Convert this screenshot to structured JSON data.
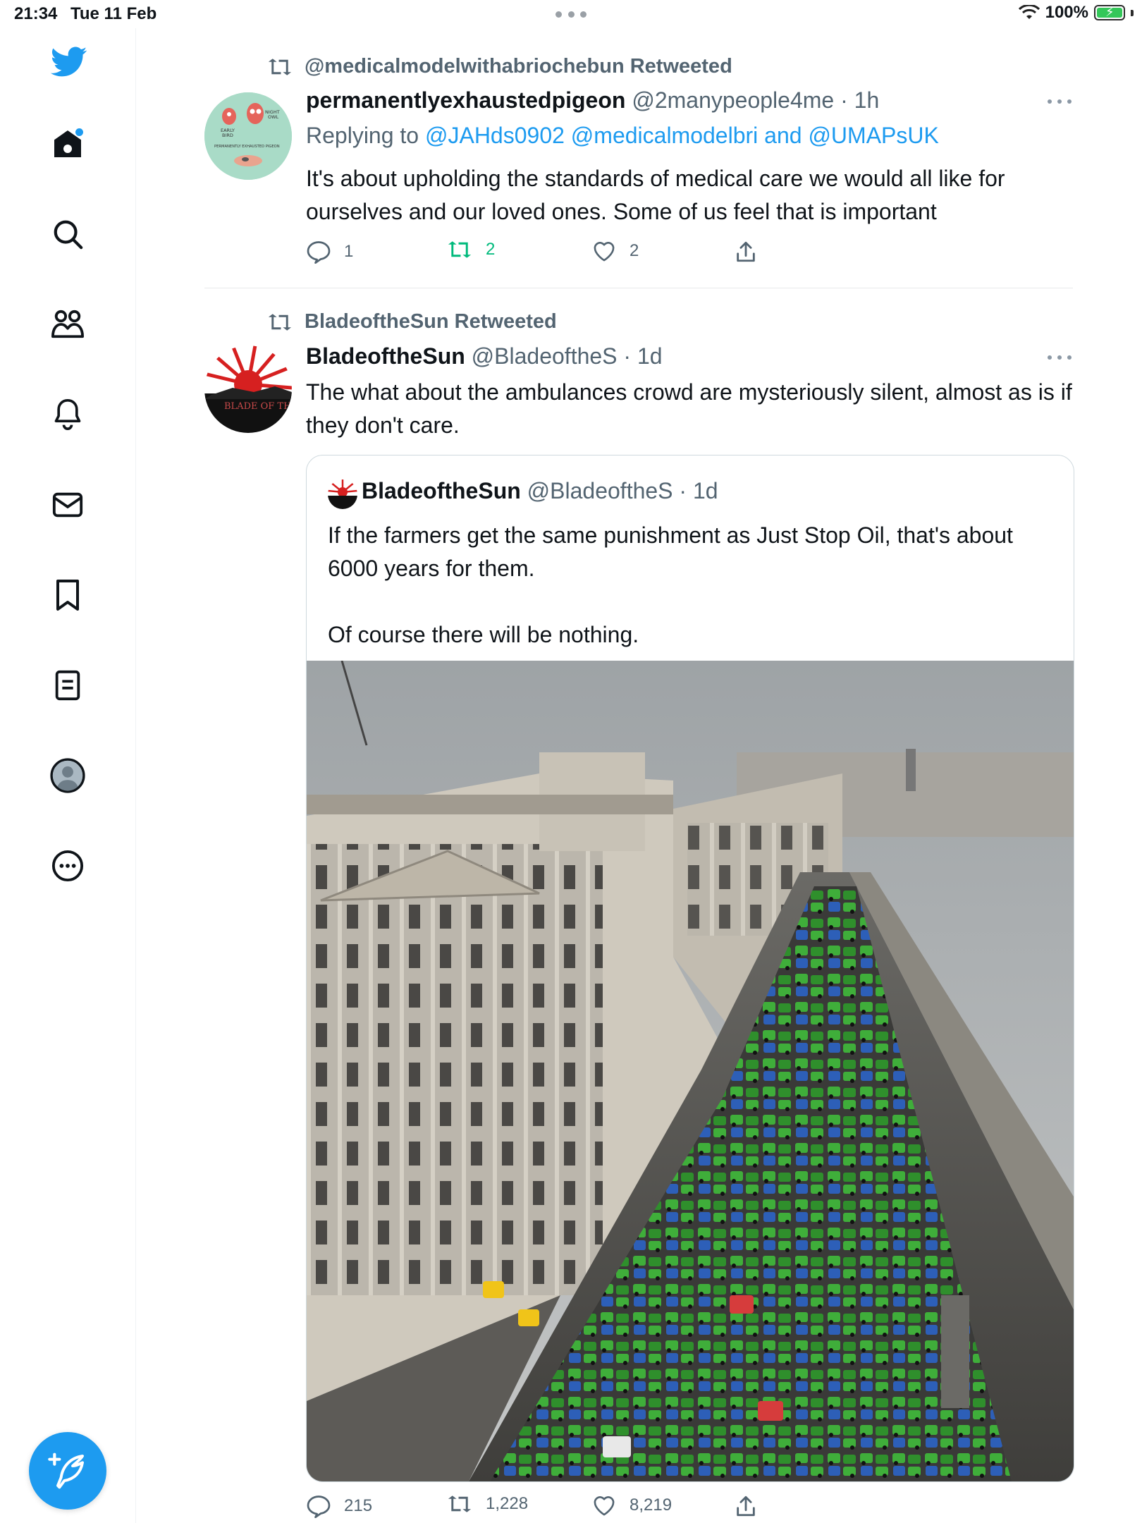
{
  "status_bar": {
    "time": "21:34",
    "date": "Tue 11 Feb",
    "battery": "100%"
  },
  "sidebar": {
    "items": [
      {
        "name": "twitter-logo"
      },
      {
        "name": "home"
      },
      {
        "name": "explore"
      },
      {
        "name": "communities"
      },
      {
        "name": "notifications"
      },
      {
        "name": "messages"
      },
      {
        "name": "bookmarks"
      },
      {
        "name": "lists"
      },
      {
        "name": "profile"
      },
      {
        "name": "more"
      }
    ],
    "compose_label": "Tweet"
  },
  "tweets": [
    {
      "retweeted_by": "@medicalmodelwithabriochebun Retweeted",
      "display_name": "permanentlyexhaustedpigeon",
      "handle_time": "@2manypeople4me · 1h",
      "replying_prefix": "Replying to",
      "replying_to_1": "@JAHds0902",
      "replying_to_2": "@medicalmodelbri",
      "replying_and": "and",
      "replying_to_3": "@UMAPsUK",
      "text": "It's about upholding the standards of medical care we would all like for ourselves and our loved ones. Some of us feel that is important",
      "avatar_text": {
        "early": "EARLY",
        "bird": "BIRD",
        "night": "NIGHT",
        "owl": "OWL",
        "caption": "PERMANENTLY EXHAUSTED PIGEON"
      },
      "replies": "1",
      "retweets": "2",
      "likes": "2"
    },
    {
      "retweeted_by": "BladeoftheSun Retweeted",
      "display_name": "BladeoftheSun",
      "handle_time": "@BladeoftheS · 1d",
      "text": "The what about the ambulances crowd are mysteriously silent, almost as is if they don't care.",
      "avatar_text": "BLADE OF THE",
      "replies": "215",
      "retweets": "1,228",
      "likes": "8,219",
      "quote": {
        "display_name": "BladeoftheSun",
        "handle_time": "@BladeoftheS · 1d",
        "text_1": "If the farmers get the same punishment as Just Stop Oil, that's about 6000 years for them.",
        "text_2": "Of course there will be nothing."
      }
    }
  ],
  "colors": {
    "accent": "#1d9bf0",
    "retweet_green": "#00ba7c",
    "muted": "#536471"
  }
}
